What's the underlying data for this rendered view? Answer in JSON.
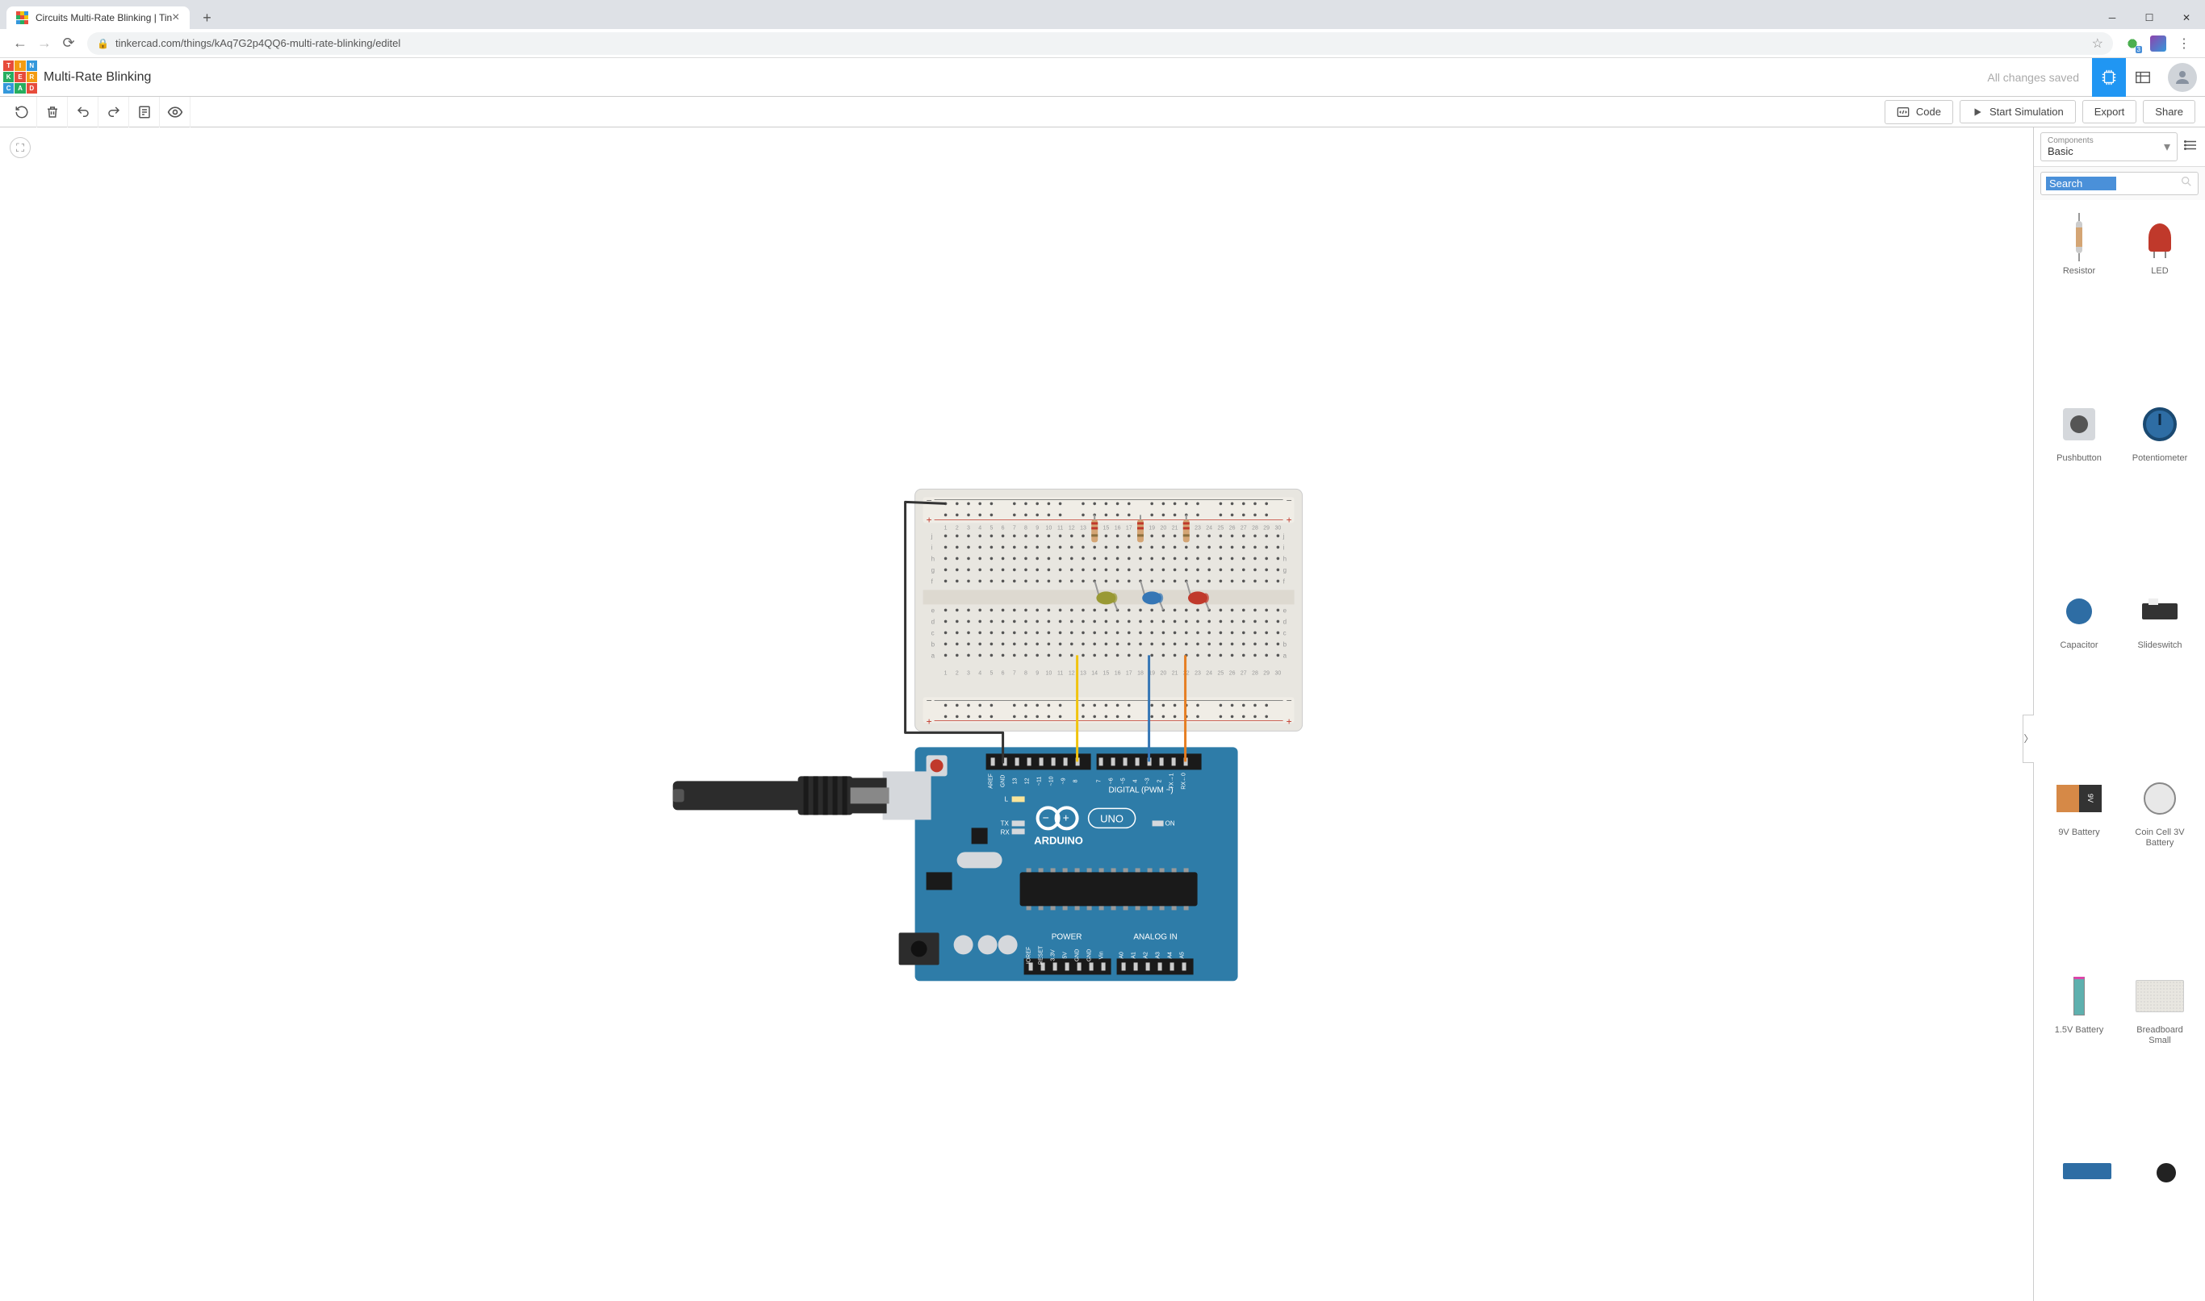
{
  "browser": {
    "tab_title": "Circuits Multi-Rate Blinking | Tin",
    "url": "tinkercad.com/things/kAq7G2p4QQ6-multi-rate-blinking/editel",
    "new_tab": "+",
    "close_tab": "×"
  },
  "header": {
    "project_title": "Multi-Rate Blinking",
    "save_status": "All changes saved",
    "logo_chars": [
      "T",
      "I",
      "N",
      "K",
      "E",
      "R",
      "C",
      "A",
      "D"
    ],
    "logo_colors": [
      "#e74c3c",
      "#f39c12",
      "#3498db",
      "#27ae60",
      "#e74c3c",
      "#f39c12",
      "#3498db",
      "#27ae60",
      "#e74c3c"
    ]
  },
  "toolbar": {
    "code_btn": "Code",
    "simulate_btn": "Start Simulation",
    "export_btn": "Export",
    "share_btn": "Share"
  },
  "canvas": {
    "arduino_label": "ARDUINO",
    "uno_label": "UNO",
    "digital_label": "DIGITAL (PWM ~)",
    "power_label": "POWER",
    "analog_label": "ANALOG IN",
    "on_label": "ON",
    "l_label": "L",
    "tx_label": "TX",
    "rx_label": "RX",
    "top_pins": [
      "AREF",
      "GND",
      "13",
      "12",
      "~11",
      "~10",
      "~9",
      "8",
      "",
      "7",
      "~6",
      "~5",
      "4",
      "~3",
      "2",
      "TX→1",
      "RX←0"
    ],
    "bottom_pins_left": [
      "IOREF",
      "RESET",
      "3.3V",
      "5V",
      "GND",
      "GND",
      "Vin"
    ],
    "bottom_pins_right": [
      "A0",
      "A1",
      "A2",
      "A3",
      "A4",
      "A5"
    ],
    "led_colors": [
      "#999933",
      "#3576b5",
      "#c0392b"
    ],
    "wire_colors": {
      "yellow": "#f1c40f",
      "blue": "#3576b5",
      "orange": "#e67e22",
      "black": "#333"
    }
  },
  "components_panel": {
    "header_label": "Components",
    "category": "Basic",
    "search_placeholder": "Search",
    "items": [
      {
        "label": "Resistor"
      },
      {
        "label": "LED"
      },
      {
        "label": "Pushbutton"
      },
      {
        "label": "Potentiometer"
      },
      {
        "label": "Capacitor"
      },
      {
        "label": "Slideswitch"
      },
      {
        "label": "9V Battery"
      },
      {
        "label": "Coin Cell 3V Battery"
      },
      {
        "label": "1.5V Battery"
      },
      {
        "label": "Breadboard Small"
      }
    ]
  }
}
